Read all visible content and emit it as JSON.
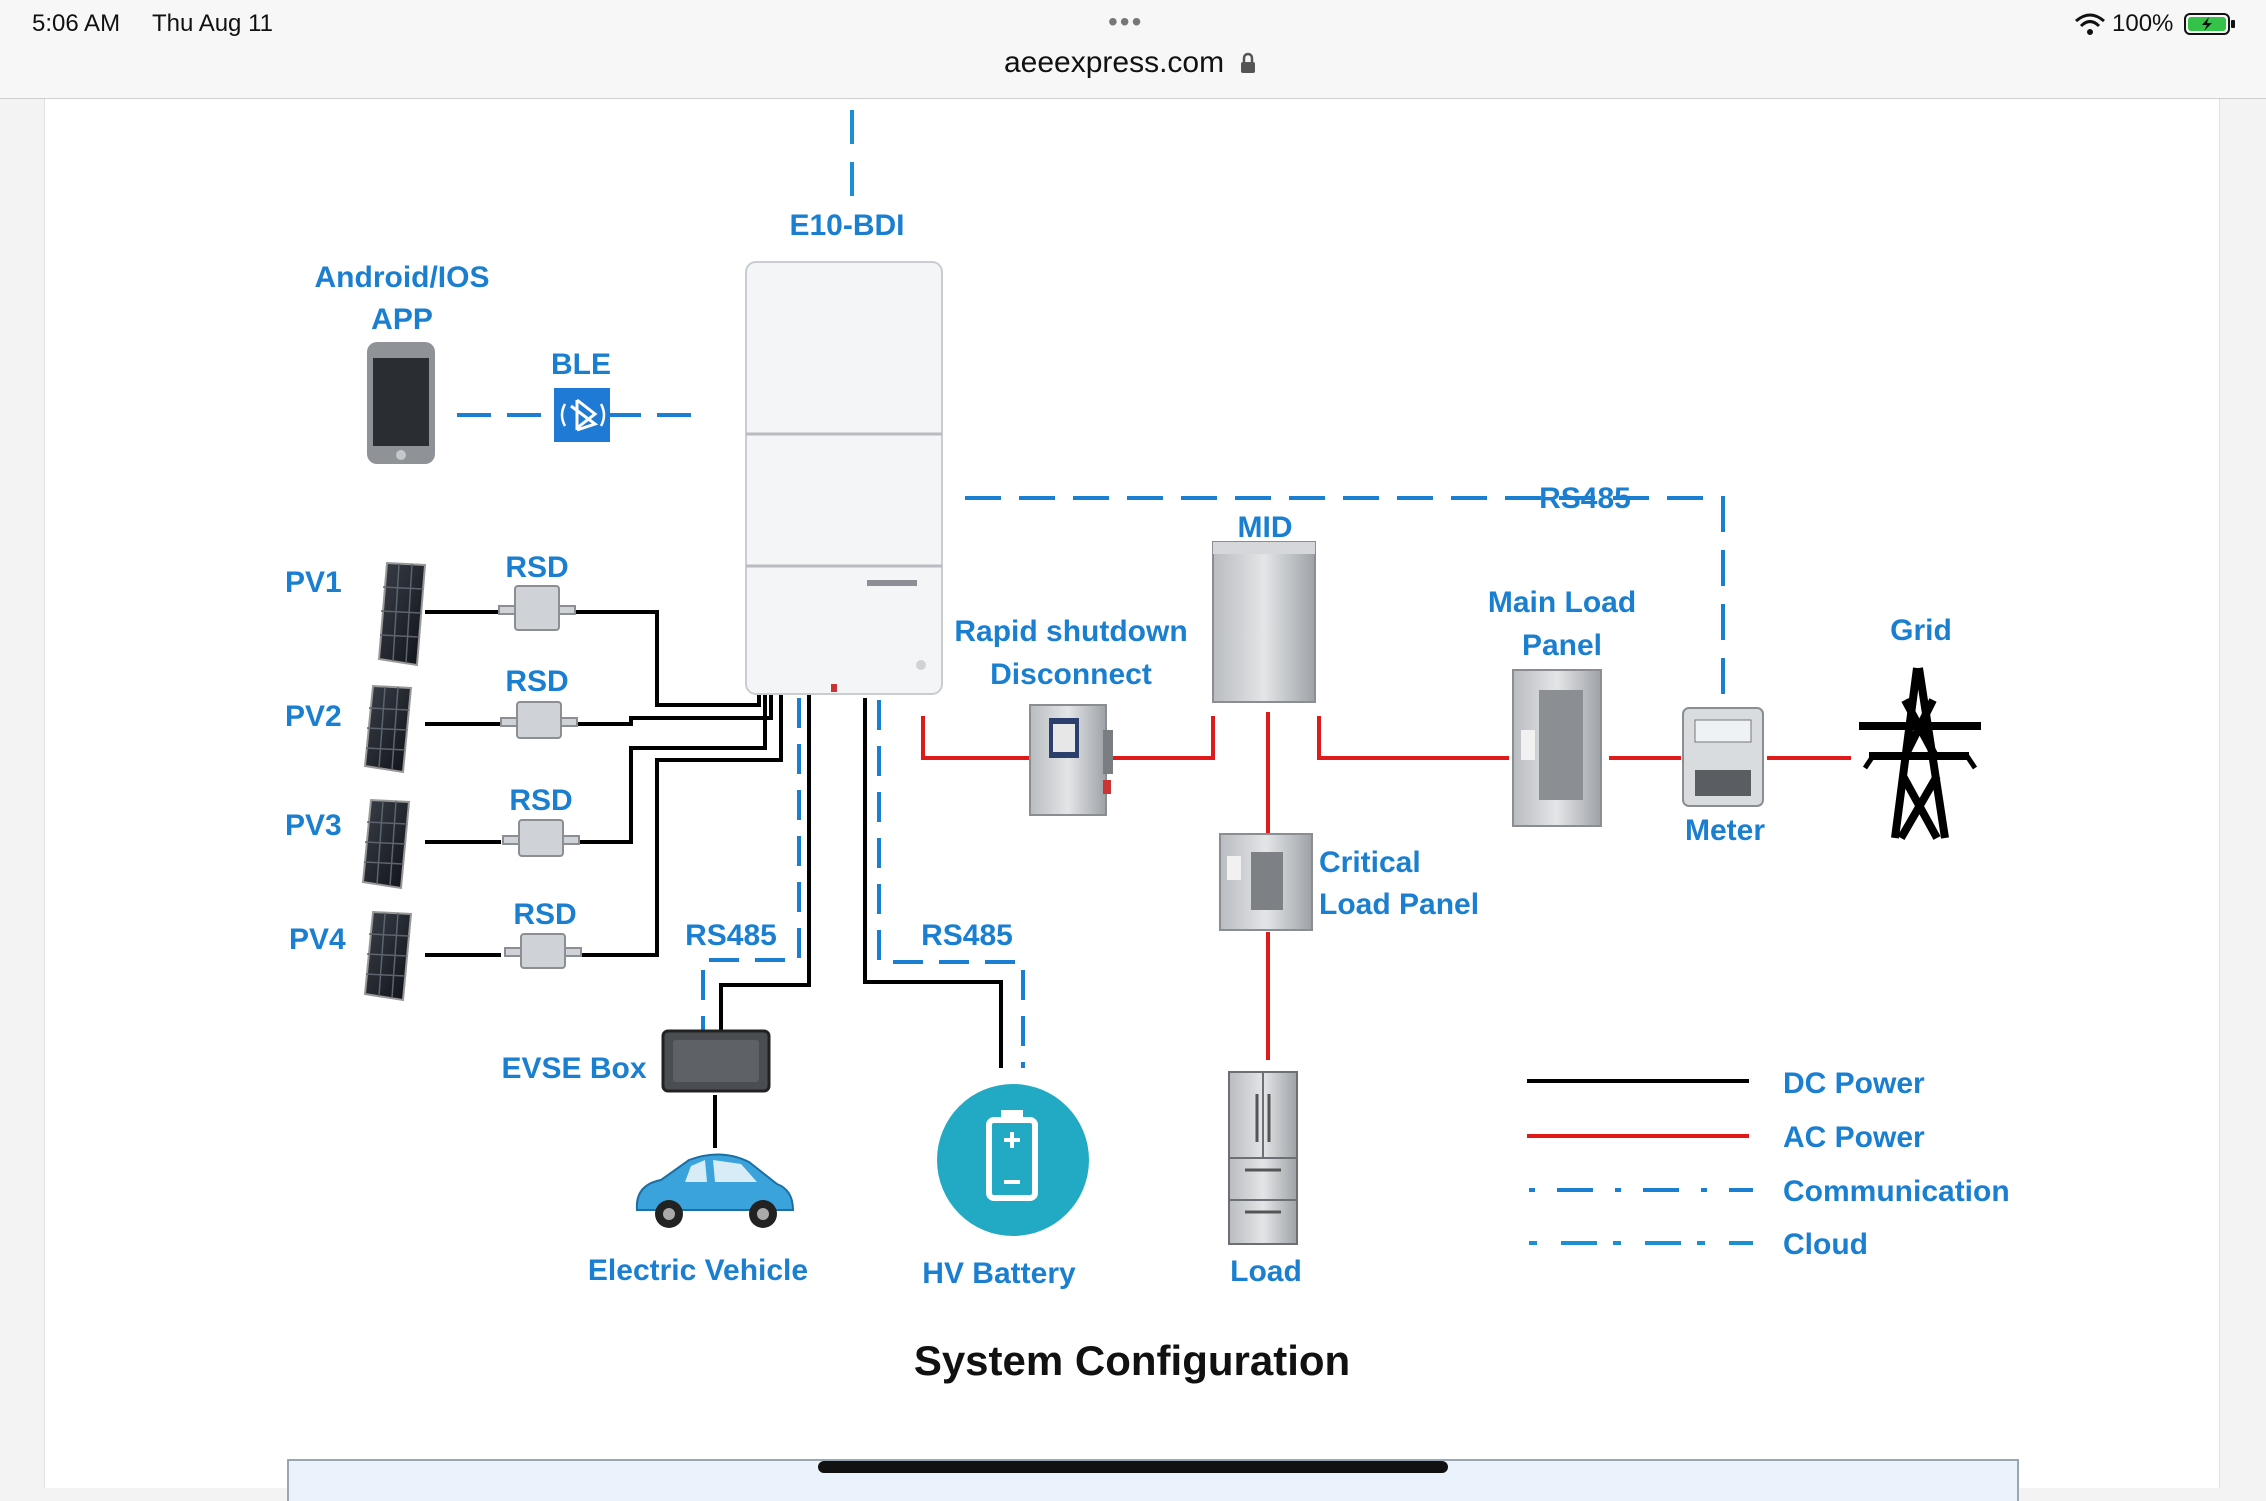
{
  "status_bar": {
    "time": "5:06 AM",
    "date": "Thu Aug 11",
    "url": "aeeexpress.com",
    "battery": "100%",
    "icons": [
      "lock-icon",
      "wifi-icon",
      "battery-charging-icon"
    ]
  },
  "diagram": {
    "inverter": "E10-BDI",
    "app_label_1": "Android/IOS",
    "app_label_2": "APP",
    "ble": "BLE",
    "pv": [
      "PV1",
      "PV2",
      "PV3",
      "PV4"
    ],
    "rsd": [
      "RSD",
      "RSD",
      "RSD",
      "RSD"
    ],
    "rs485_top": "RS485",
    "rs485_evse": "RS485",
    "rs485_battery": "RS485",
    "mid": "MID",
    "rapid_1": "Rapid shutdown",
    "rapid_2": "Disconnect",
    "main_load_1": "Main Load",
    "main_load_2": "Panel",
    "grid": "Grid",
    "meter": "Meter",
    "critical_1": "Critical",
    "critical_2": "Load Panel",
    "evse": "EVSE Box",
    "ev": "Electric Vehicle",
    "battery": "HV Battery",
    "load": "Load",
    "caption": "System Configuration",
    "legend": [
      {
        "label": "DC Power",
        "color": "#000000",
        "style": "solid"
      },
      {
        "label": "AC Power",
        "color": "#e01a1a",
        "style": "solid"
      },
      {
        "label": "Communication",
        "color": "#1a7fd0",
        "style": "dash-dot"
      },
      {
        "label": "Cloud",
        "color": "#1a90d0",
        "style": "dashed"
      }
    ]
  }
}
